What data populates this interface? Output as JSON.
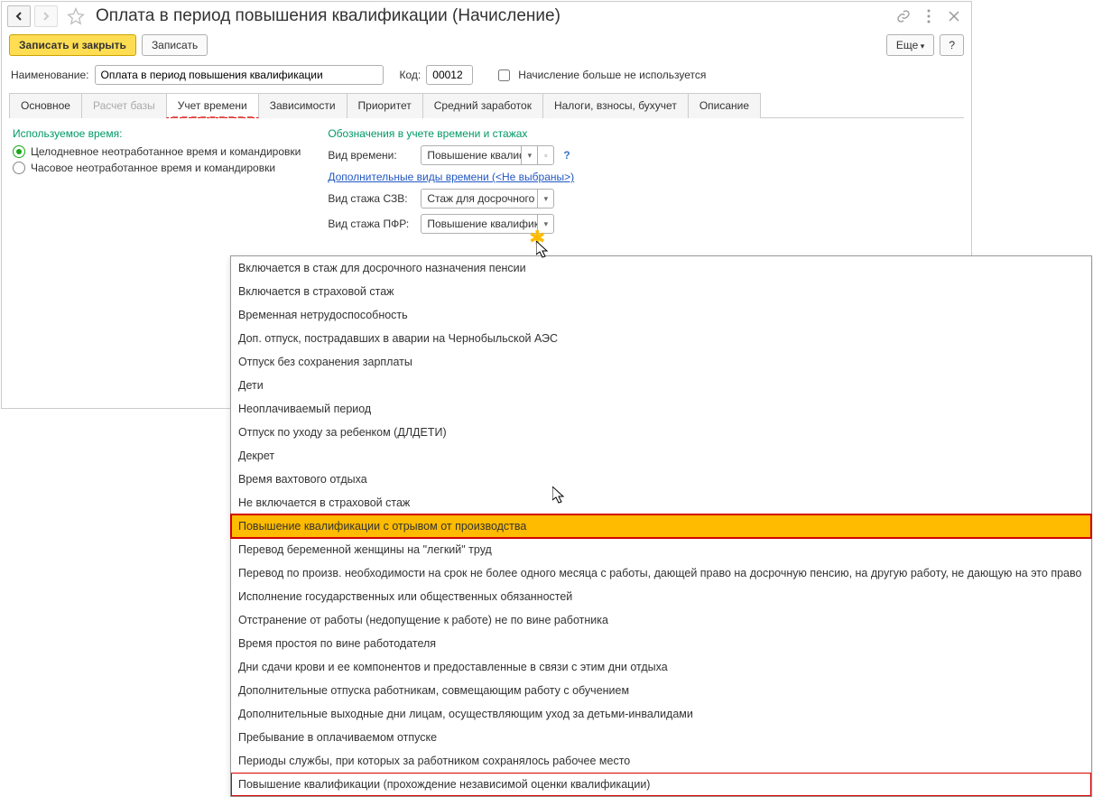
{
  "header": {
    "title": "Оплата в период повышения квалификации (Начисление)"
  },
  "toolbar": {
    "save_close": "Записать и закрыть",
    "save": "Записать",
    "more": "Еще",
    "help": "?"
  },
  "form": {
    "name_label": "Наименование:",
    "name_value": "Оплата в период повышения квалификации",
    "code_label": "Код:",
    "code_value": "00012",
    "unused_label": "Начисление больше не используется"
  },
  "tabs": [
    {
      "label": "Основное"
    },
    {
      "label": "Расчет базы"
    },
    {
      "label": "Учет времени"
    },
    {
      "label": "Зависимости"
    },
    {
      "label": "Приоритет"
    },
    {
      "label": "Средний заработок"
    },
    {
      "label": "Налоги, взносы, бухучет"
    },
    {
      "label": "Описание"
    }
  ],
  "left_col": {
    "title": "Используемое время:",
    "opt1": "Целодневное неотработанное время и командировки",
    "opt2": "Часовое неотработанное время и командировки"
  },
  "right_col": {
    "title": "Обозначения в учете времени и стажах",
    "vid_vremeni_label": "Вид времени:",
    "vid_vremeni_value": "Повышение квалифика",
    "dop_link": "Дополнительные виды времени (<Не выбраны>)",
    "szv_label": "Вид стажа СЗВ:",
    "szv_value": "Стаж для досрочного на",
    "pfr_label": "Вид стажа ПФР:",
    "pfr_value": "Повышение квалифика"
  },
  "dropdown": {
    "items": [
      "Включается в стаж для досрочного назначения пенсии",
      "Включается в страховой стаж",
      "Временная нетрудоспособность",
      "Доп. отпуск, пострадавших в аварии на Чернобыльской АЭС",
      "Отпуск без сохранения зарплаты",
      "Дети",
      "Неоплачиваемый период",
      "Отпуск по уходу за ребенком (ДЛДЕТИ)",
      "Декрет",
      "Время вахтового отдыха",
      "Не включается в страховой стаж",
      "Повышение квалификации с отрывом от производства",
      "Перевод беременной женщины на \"легкий\" труд",
      "Перевод по произв. необходимости на срок не более одного месяца с работы, дающей право на досрочную пенсию, на другую работу, не дающую на это право",
      "Исполнение государственных или общественных обязанностей",
      "Отстранение от работы (недопущение к работе) не по вине работника",
      "Время простоя по вине работодателя",
      "Дни сдачи крови и ее компонентов и предоставленные в связи с этим дни отдыха",
      "Дополнительные отпуска работникам, совмещающим работу с обучением",
      "Дополнительные выходные дни лицам, осуществляющим уход за детьми-инвалидами",
      "Пребывание в оплачиваемом отпуске",
      "Периоды службы, при которых за работником сохранялось рабочее место",
      "Повышение квалификации (прохождение независимой оценки квалификации)"
    ],
    "selected_index": 11,
    "boxed_index": 22
  }
}
